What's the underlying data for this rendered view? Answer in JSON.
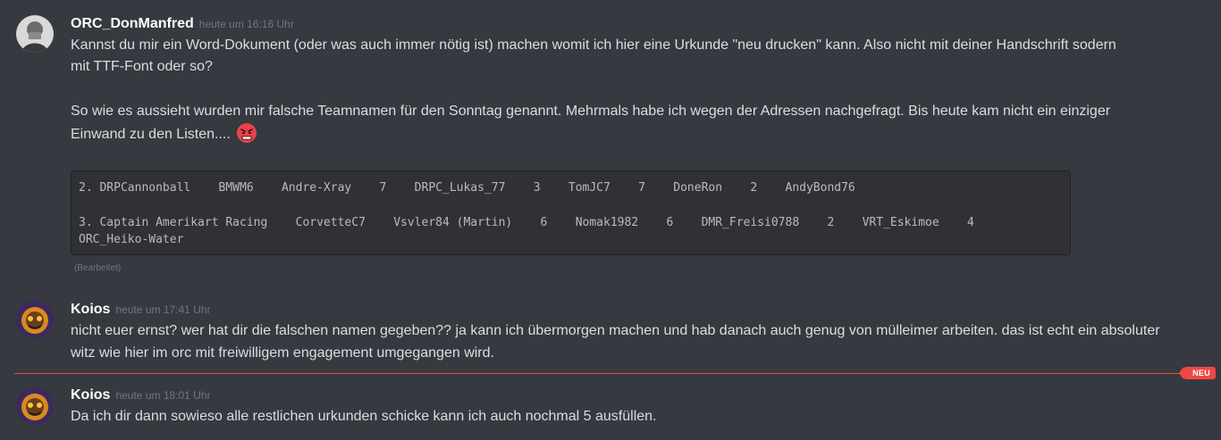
{
  "messages": [
    {
      "username": "ORC_DonManfred",
      "timestamp": "heute um 16:16 Uhr",
      "lines": [
        "Kannst du mir ein Word-Dokument (oder was auch immer nötig ist) machen womit ich hier eine Urkunde \"neu drucken\" kann. Also nicht mit deiner Handschrift sodern",
        "mit TTF-Font oder so?",
        "So wie es aussieht wurden mir falsche Teamnamen für den Sonntag genannt. Mehrmals habe ich wegen der Adressen nachgefragt. Bis heute kam nicht ein einziger",
        "Einwand zu den Listen...."
      ],
      "emoji": "angry-face-emoji",
      "code_lines": [
        "2. DRPCannonball    BMWM6    Andre-Xray    7    DRPC_Lukas_77    3    TomJC7    7    DoneRon    2    AndyBond76",
        "3. Captain Amerikart Racing    CorvetteC7    Vsvler84 (Martin)    6    Nomak1982    6    DMR_Freisi0788    2    VRT_Eskimoe    4",
        "ORC_Heiko-Water"
      ],
      "edited_label": "(Bearbeitet)"
    },
    {
      "username": "Koios",
      "timestamp": "heute um 17:41 Uhr",
      "lines": [
        "nicht euer ernst? wer hat dir die falschen namen gegeben?? ja kann ich übermorgen machen und hab danach auch genug von mülleimer arbeiten. das ist echt ein absoluter",
        "witz wie hier im orc mit freiwilligem engagement umgegangen wird."
      ]
    },
    {
      "username": "Koios",
      "timestamp": "heute um 18:01 Uhr",
      "lines": [
        "Da ich dir dann sowieso alle restlichen urkunden schicke kann ich auch nochmal 5 ausfüllen."
      ]
    }
  ],
  "new_divider": {
    "label": "NEU",
    "color": "#f04747"
  },
  "colors": {
    "background": "#36393f",
    "code_background": "#2f3136",
    "text": "#dcddde",
    "username": "#ffffff",
    "timestamp": "#72767d"
  }
}
